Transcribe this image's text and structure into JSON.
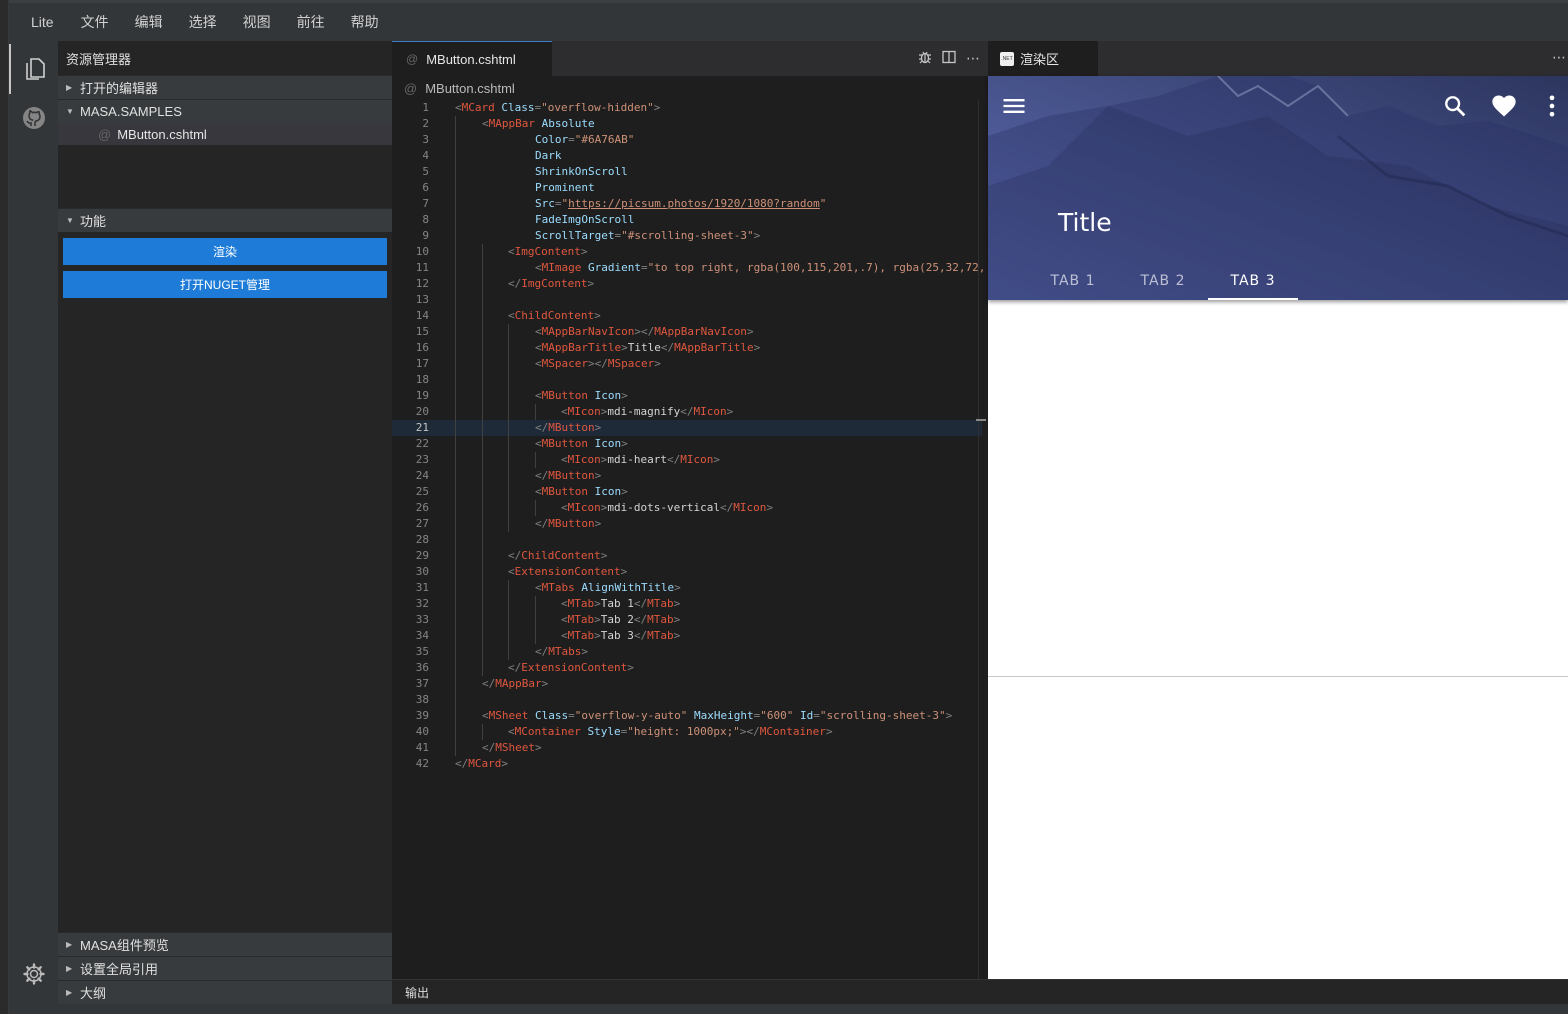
{
  "menubar": {
    "items": [
      "Lite",
      "文件",
      "编辑",
      "选择",
      "视图",
      "前往",
      "帮助"
    ]
  },
  "sidebar": {
    "title": "资源管理器",
    "sections": {
      "open_editors": "打开的编辑器",
      "samples": "MASA.SAMPLES",
      "features": "功能",
      "preview": "MASA组件预览",
      "global_ref": "设置全局引用",
      "outline": "大纲"
    },
    "file": "MButton.cshtml",
    "buttons": {
      "render": "渲染",
      "nuget": "打开NUGET管理"
    }
  },
  "editor": {
    "tab": "MButton.cshtml",
    "breadcrumb": "MButton.cshtml",
    "current_line": 21
  },
  "output_label": "输出",
  "render_panel": {
    "tab": "渲染区",
    "net_badge": ".NET",
    "title": "Title",
    "tabs": [
      "TAB 1",
      "TAB 2",
      "TAB 3"
    ],
    "active_tab": 2
  },
  "colors": {
    "accent": "#1e7cd8",
    "appbar": "#6A76AB"
  },
  "icons": {
    "menu": "menu-icon",
    "search": "magnify-icon",
    "heart": "heart-icon",
    "more": "dots-vertical-icon"
  }
}
